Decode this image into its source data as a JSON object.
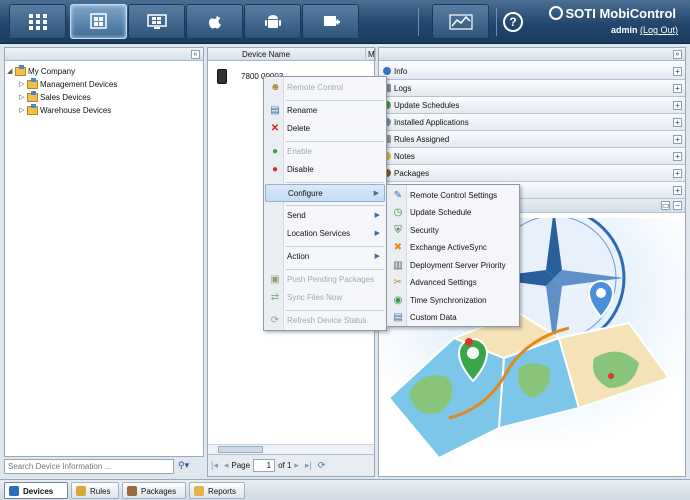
{
  "app": {
    "brand": "SOTI MobiControl",
    "user": "admin",
    "logout": "(Log Out)"
  },
  "nav": {
    "buttons": [
      "grid-icon",
      "windows-icon",
      "windows-legacy-icon",
      "apple-icon",
      "android-icon",
      "add-device-icon",
      "chart-icon",
      "help-icon"
    ]
  },
  "tree": {
    "root": "My Company",
    "children": [
      "Management Devices",
      "Sales Devices",
      "Warehouse Devices"
    ]
  },
  "search": {
    "placeholder": "Search Device Information ..."
  },
  "devices": {
    "columns": [
      "Device Name",
      "M"
    ],
    "rows": [
      {
        "name": "7800 00003"
      }
    ]
  },
  "pager": {
    "label": "Page",
    "current": "1",
    "of": "of 1"
  },
  "info_panels": [
    "Info",
    "Logs",
    "Update Schedules",
    "Installed Applications",
    "Rules Assigned",
    "Notes",
    "Packages"
  ],
  "context_menu": {
    "items": [
      {
        "label": "Remote Control",
        "disabled": true
      },
      {
        "label": "Rename",
        "disabled": false
      },
      {
        "label": "Delete",
        "disabled": false
      },
      {
        "label": "Enable",
        "disabled": true
      },
      {
        "label": "Disable",
        "disabled": false
      },
      {
        "label": "Configure",
        "disabled": false,
        "submenu": true
      },
      {
        "label": "Send",
        "disabled": false,
        "submenu": true
      },
      {
        "label": "Location Services",
        "disabled": false,
        "submenu": true
      },
      {
        "label": "Action",
        "disabled": false,
        "submenu": true
      },
      {
        "label": "Push Pending Packages",
        "disabled": true
      },
      {
        "label": "Sync Files Now",
        "disabled": true
      },
      {
        "label": "Refresh Device Status",
        "disabled": true
      }
    ]
  },
  "configure_menu": {
    "items": [
      "Remote Control Settings",
      "Update Schedule",
      "Security",
      "Exchange ActiveSync",
      "Deployment Server Priority",
      "Advanced Settings",
      "Time Synchronization",
      "Custom Data"
    ]
  },
  "bottom_tabs": [
    "Devices",
    "Rules",
    "Packages",
    "Reports"
  ],
  "colors": {
    "topbar": "#23476d",
    "highlight": "#c6dbf1",
    "accent": "#3e6a9c"
  }
}
